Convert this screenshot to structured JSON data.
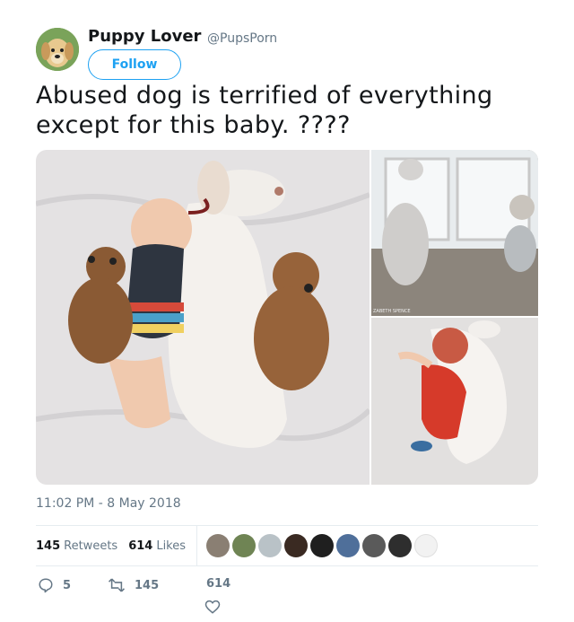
{
  "author": {
    "display_name": "Puppy Lover",
    "handle": "@PupsPorn",
    "follow_label": "Follow"
  },
  "tweet": {
    "text": "Abused dog is terrified of everything except for this baby. ????",
    "timestamp": "11:02 PM - 8 May 2018",
    "photo_caption": "ZABETH SPENCE"
  },
  "stats": {
    "retweets": "145",
    "retweets_label": "Retweets",
    "likes": "614",
    "likes_label": "Likes"
  },
  "actions": {
    "replies": "5",
    "retweets": "145",
    "likes": "614"
  },
  "colors": {
    "brand": "#1da1f2",
    "secondary_text": "#657786",
    "divider": "#e6ecf0"
  },
  "icons": [
    "reply-icon",
    "retweet-icon",
    "heart-icon"
  ]
}
